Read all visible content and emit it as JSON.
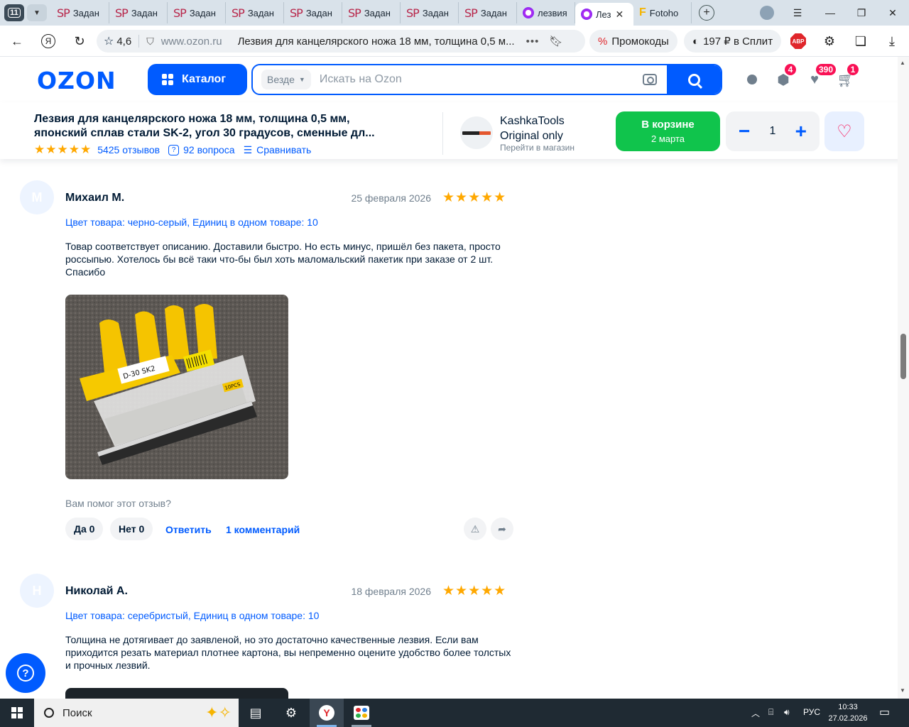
{
  "browser": {
    "tab_count": "11",
    "tabs": [
      {
        "icon": "SP",
        "label": "Задан"
      },
      {
        "icon": "SP",
        "label": "Задан"
      },
      {
        "icon": "SP",
        "label": "Задан"
      },
      {
        "icon": "SP",
        "label": "Задан"
      },
      {
        "icon": "SP",
        "label": "Задан"
      },
      {
        "icon": "SP",
        "label": "Задан"
      },
      {
        "icon": "SP",
        "label": "Задан"
      },
      {
        "icon": "SP",
        "label": "Задан"
      },
      {
        "icon": "ozon",
        "label": "лезвия"
      },
      {
        "icon": "ozon",
        "label": "Лез",
        "active": true
      },
      {
        "icon": "F",
        "label": "Fotoho"
      }
    ],
    "new_tab": "+",
    "site_rating": "4,6",
    "domain": "www.ozon.ru",
    "page_title": "Лезвия для канцелярского ножа 18 мм, толщина 0,5 м...",
    "promo_label": "Промокоды",
    "split_label": "197 ₽ в Сплит",
    "abp_label": "ABP"
  },
  "header": {
    "logo": "OZON",
    "catalog_label": "Каталог",
    "search_scope": "Везде",
    "search_placeholder": "Искать на Ozon",
    "badges": {
      "orders": "4",
      "favorites": "390",
      "cart": "1"
    }
  },
  "product_bar": {
    "title": "Лезвия для канцелярского ножа 18 мм, толщина 0,5 мм, японский сплав стали SK-2, угол 30 градусов, сменные дл...",
    "stars": "★★★★★",
    "reviews": "5425 отзывов",
    "questions": "92 вопроса",
    "compare": "Сравнивать",
    "seller_name_1": "KashkaTools",
    "seller_name_2": "Original only",
    "seller_link": "Перейти в магазин",
    "cart_label": "В корзине",
    "cart_date": "2 марта",
    "quantity": "1"
  },
  "reviews": [
    {
      "initial": "М",
      "author": "Михаил М.",
      "date": "25 февраля 2026",
      "stars": "★★★★★",
      "rating": 5,
      "variant": "Цвет товара: черно-серый, Единиц в одном товаре: 10",
      "text": "Товар соответствует описанию. Доставили быстро. Но есть минус, пришёл без пакета, просто россыпью. Хотелось бы всё таки что-бы был хоть маломальский пакетик при заказе от 2 шт. Спасибо",
      "photo_labels": [
        "D-30 SK2",
        "10PCS"
      ],
      "helpful_question": "Вам помог этот отзыв?",
      "yes": "Да 0",
      "no": "Нет 0",
      "reply": "Ответить",
      "comments": "1 комментарий"
    },
    {
      "initial": "Н",
      "author": "Николай А.",
      "date": "18 февраля 2026",
      "stars": "★★★★★",
      "rating": 5,
      "variant": "Цвет товара: серебристый, Единиц в одном товаре: 10",
      "text": "Толщина не дотягивает до заявленой, но это достаточно качественные лезвия. Если вам приходится резать материал плотнее картона, вы непременно оцените удобство более толстых и прочных лезвий."
    }
  ],
  "help_button": "?",
  "taskbar": {
    "search_label": "Поиск",
    "lang": "РУС",
    "time": "10:33",
    "date": "27.02.2026"
  },
  "colors": {
    "ozon_blue": "#005bff",
    "cart_green": "#10c44c",
    "badge_pink": "#f91155",
    "star_orange": "#ffa800"
  }
}
